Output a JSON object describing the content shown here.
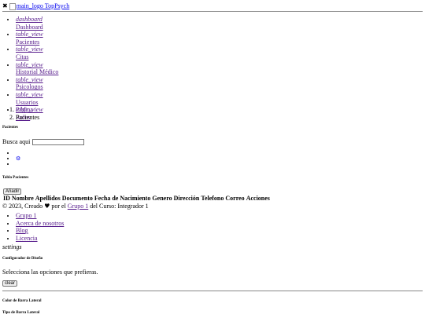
{
  "header": {
    "logo_alt": "main_logo",
    "brand": "TopPsych"
  },
  "nav": {
    "items": [
      {
        "icon": "dashboard",
        "label": "Dashboard"
      },
      {
        "icon": "table_view",
        "label": "Pacientes"
      },
      {
        "icon": "table_view",
        "label": "Citas"
      },
      {
        "icon": "table_view",
        "label": "Historial Médico"
      },
      {
        "icon": "table_view",
        "label": "Psicologos"
      },
      {
        "icon": "table_view",
        "label": "Usuarios"
      },
      {
        "icon": "table_view",
        "label": "Roles"
      }
    ]
  },
  "breadcrumb": {
    "items": [
      "Página",
      "Pacientes"
    ]
  },
  "page_title": "Pacientes",
  "search": {
    "label": "Busca aqui",
    "value": ""
  },
  "table": {
    "title": "Tabla Pacientes",
    "add_label": "Añadir",
    "headers": [
      "ID",
      "Nombre",
      "Apellidos",
      "Documento",
      "Fecha de Nacimiento",
      "Genero",
      "Dirección",
      "Telefono",
      "Correo",
      "Acciones"
    ]
  },
  "footer": {
    "copyright": "© 2023, Creado",
    "by": "por el",
    "group_link": "Grupo 1",
    "course": "del Curso: Integrador 1",
    "links": [
      "Grupo 1",
      "Acerca de nosotros",
      "Blog",
      "Licencia"
    ]
  },
  "config": {
    "settings_icon_text": "settings",
    "title": "Configurador de Diseño",
    "description": "Selecciona las opciones que prefieras.",
    "clear_label": "clear",
    "sidebar_color": "Color de Barra Lateral",
    "sidebar_type": "Tipo de Barra Lateral"
  }
}
